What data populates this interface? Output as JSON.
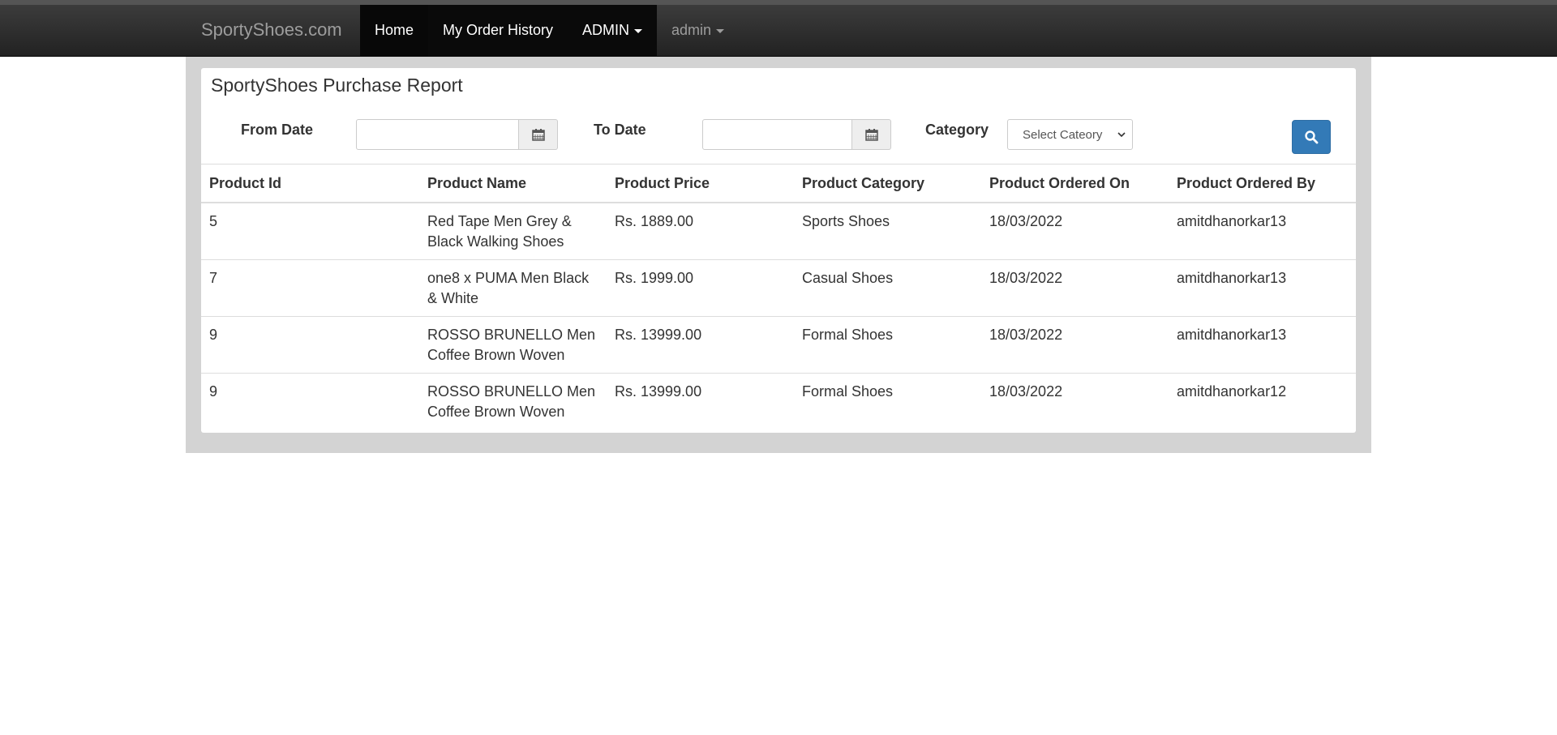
{
  "navbar": {
    "brand": "SportyShoes.com",
    "items": [
      {
        "label": "Home"
      },
      {
        "label": "My Order History"
      },
      {
        "label": "ADMIN"
      },
      {
        "label": "admin"
      }
    ]
  },
  "report": {
    "title": "SportyShoes Purchase Report",
    "filters": {
      "from_date_label": "From Date",
      "from_date_value": "",
      "to_date_label": "To Date",
      "to_date_value": "",
      "category_label": "Category",
      "category_selected": "Select Cateory"
    },
    "columns": [
      "Product Id",
      "Product Name",
      "Product Price",
      "Product Category",
      "Product Ordered On",
      "Product Ordered By"
    ],
    "rows": [
      {
        "id": "5",
        "name": "Red Tape Men Grey & Black Walking Shoes",
        "price": "Rs. 1889.00",
        "category": "Sports Shoes",
        "ordered_on": "18/03/2022",
        "ordered_by": "amitdhanorkar13"
      },
      {
        "id": "7",
        "name": "one8 x PUMA Men Black & White",
        "price": "Rs. 1999.00",
        "category": "Casual Shoes",
        "ordered_on": "18/03/2022",
        "ordered_by": "amitdhanorkar13"
      },
      {
        "id": "9",
        "name": "ROSSO BRUNELLO Men Coffee Brown Woven",
        "price": "Rs. 13999.00",
        "category": "Formal Shoes",
        "ordered_on": "18/03/2022",
        "ordered_by": "amitdhanorkar13"
      },
      {
        "id": "9",
        "name": "ROSSO BRUNELLO Men Coffee Brown Woven",
        "price": "Rs. 13999.00",
        "category": "Formal Shoes",
        "ordered_on": "18/03/2022",
        "ordered_by": "amitdhanorkar12"
      }
    ]
  },
  "icons": {
    "calendar": "calendar-icon",
    "search": "search-icon",
    "caret": "caret-down-icon"
  },
  "colors": {
    "navbar": "#222222",
    "primary_button": "#337ab7",
    "well": "#d3d3d3"
  }
}
